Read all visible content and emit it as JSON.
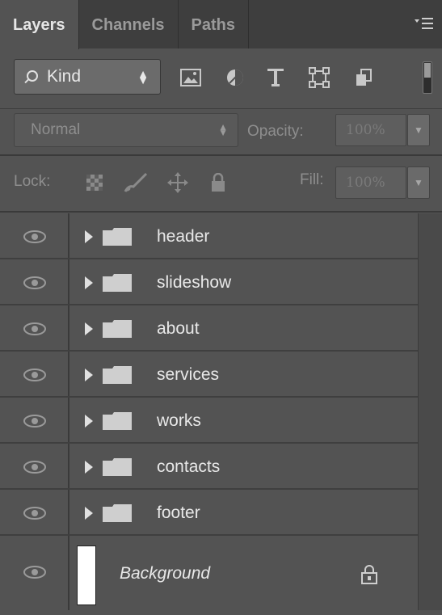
{
  "tabs": [
    {
      "label": "Layers",
      "active": true
    },
    {
      "label": "Channels",
      "active": false
    },
    {
      "label": "Paths",
      "active": false
    }
  ],
  "filter": {
    "kind_label": "Kind",
    "icons": [
      "image-filter-icon",
      "adjustment-filter-icon",
      "type-filter-icon",
      "shape-filter-icon",
      "smart-object-filter-icon"
    ]
  },
  "blend": {
    "mode": "Normal",
    "opacity_label": "Opacity:",
    "opacity_value": "100%"
  },
  "lock": {
    "label": "Lock:",
    "fill_label": "Fill:",
    "fill_value": "100%"
  },
  "layers": [
    {
      "name": "header",
      "type": "group",
      "visible": true
    },
    {
      "name": "slideshow",
      "type": "group",
      "visible": true
    },
    {
      "name": "about",
      "type": "group",
      "visible": true
    },
    {
      "name": "services",
      "type": "group",
      "visible": true
    },
    {
      "name": "works",
      "type": "group",
      "visible": true
    },
    {
      "name": "contacts",
      "type": "group",
      "visible": true
    },
    {
      "name": "footer",
      "type": "group",
      "visible": true
    }
  ],
  "background_layer": {
    "name": "Background",
    "locked": true,
    "visible": true
  },
  "colors": {
    "panel": "#535353",
    "tabbar": "#3e3e3e",
    "text": "#e8e8e8",
    "muted_text": "#8e8e8e"
  }
}
